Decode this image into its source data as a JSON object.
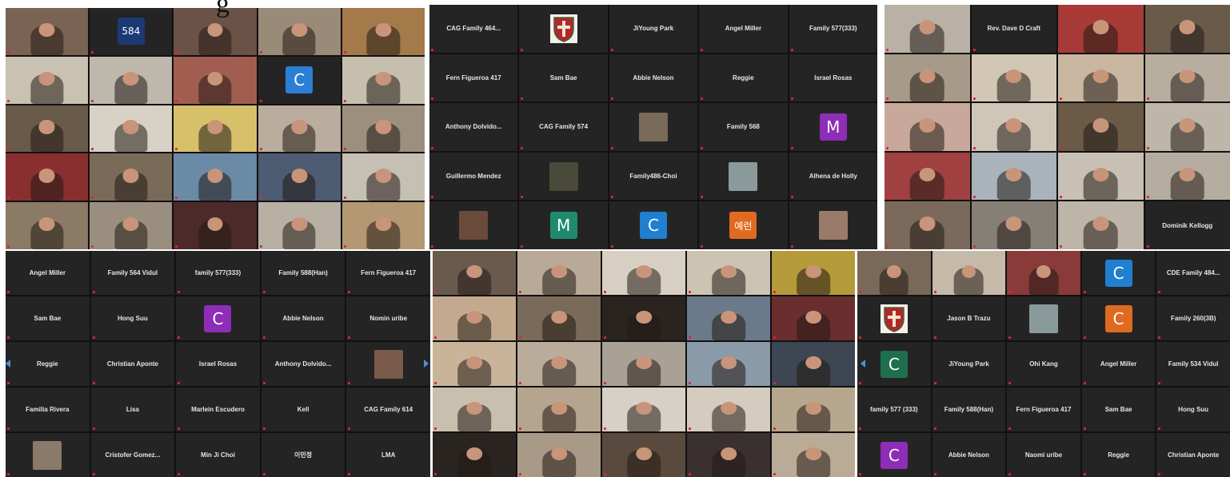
{
  "overlay_text": "g",
  "colors": {
    "panel_bg": "#1b1b1b",
    "tile_bg": "#242424",
    "name_text": "#e6e6e6"
  },
  "panels": [
    {
      "id": "p1",
      "cols": 5,
      "rows": 5,
      "tiles": [
        {
          "type": "video",
          "bg": "#7a6352"
        },
        {
          "type": "avatar",
          "text": "584",
          "color": "#1a3a74"
        },
        {
          "type": "video",
          "bg": "#6a5246"
        },
        {
          "type": "video",
          "bg": "#9a8a78"
        },
        {
          "type": "video",
          "bg": "#a47a4a"
        },
        {
          "type": "video",
          "bg": "#c9c1b2"
        },
        {
          "type": "video",
          "bg": "#bdb7ac"
        },
        {
          "type": "video",
          "bg": "#a25d51"
        },
        {
          "type": "avatar",
          "text": "C",
          "color": "#2a7fd4"
        },
        {
          "type": "video",
          "bg": "#c7bfae"
        },
        {
          "type": "video",
          "bg": "#6a5a4a"
        },
        {
          "type": "video",
          "bg": "#d8d2c6"
        },
        {
          "type": "video",
          "bg": "#d6c06a"
        },
        {
          "type": "video",
          "bg": "#b9ad9e"
        },
        {
          "type": "video",
          "bg": "#9c8f7e"
        },
        {
          "type": "video",
          "bg": "#8a2f2f"
        },
        {
          "type": "video",
          "bg": "#7a6a58"
        },
        {
          "type": "video",
          "bg": "#6a8aa6"
        },
        {
          "type": "video",
          "bg": "#4d5b73"
        },
        {
          "type": "video",
          "bg": "#c6bfb3"
        },
        {
          "type": "video",
          "bg": "#8a7a66"
        },
        {
          "type": "video",
          "bg": "#9a8e7e"
        },
        {
          "type": "video",
          "bg": "#4c2a2a"
        },
        {
          "type": "video",
          "bg": "#b8b0a2"
        },
        {
          "type": "video",
          "bg": "#b39872"
        }
      ]
    },
    {
      "id": "p2",
      "cols": 5,
      "rows": 5,
      "tiles": [
        {
          "type": "name",
          "text": "CAG Family 464..."
        },
        {
          "type": "logo"
        },
        {
          "type": "name",
          "text": "JiYoung Park"
        },
        {
          "type": "name",
          "text": "Angel Miller"
        },
        {
          "type": "name",
          "text": "Family 577(333)"
        },
        {
          "type": "name",
          "text": "Fern Figueroa 417"
        },
        {
          "type": "name",
          "text": "Sam Bae"
        },
        {
          "type": "name",
          "text": "Abbie Nelson"
        },
        {
          "type": "name",
          "text": "Reggie"
        },
        {
          "type": "name",
          "text": "Israel Rosas"
        },
        {
          "type": "name",
          "text": "Anthony  Dolvido..."
        },
        {
          "type": "name",
          "text": "CAG Family 574"
        },
        {
          "type": "photo",
          "color": "#7a6a5a"
        },
        {
          "type": "name",
          "text": "Family 568"
        },
        {
          "type": "avatar",
          "text": "M",
          "color": "#8e2db8"
        },
        {
          "type": "name",
          "text": "Guillermo Mendez"
        },
        {
          "type": "photo",
          "color": "#4a4a3a"
        },
        {
          "type": "name",
          "text": "Family486-Choi"
        },
        {
          "type": "photo",
          "color": "#8a9a9a"
        },
        {
          "type": "name",
          "text": "Alhena de Holly"
        },
        {
          "type": "photo",
          "color": "#6a4a3a"
        },
        {
          "type": "avatar",
          "text": "M",
          "color": "#1f8a6e"
        },
        {
          "type": "avatar",
          "text": "C",
          "color": "#1f7fd0"
        },
        {
          "type": "avatar",
          "text": "예런",
          "color": "#e06a20"
        },
        {
          "type": "photo",
          "color": "#9a7a6a"
        }
      ]
    },
    {
      "id": "p3",
      "cols": 4,
      "rows": 5,
      "tiles": [
        {
          "type": "video",
          "bg": "#b9b1a6"
        },
        {
          "type": "name",
          "text": "Rev. Dave D Craft"
        },
        {
          "type": "video",
          "bg": "#a73a36"
        },
        {
          "type": "video",
          "bg": "#6a5a4a"
        },
        {
          "type": "video",
          "bg": "#a89a88"
        },
        {
          "type": "video",
          "bg": "#d1c7b4"
        },
        {
          "type": "video",
          "bg": "#c9b7a2"
        },
        {
          "type": "video",
          "bg": "#b8aea0"
        },
        {
          "type": "video",
          "bg": "#c7a89a"
        },
        {
          "type": "video",
          "bg": "#cfc6b8"
        },
        {
          "type": "video",
          "bg": "#6a5a46"
        },
        {
          "type": "video",
          "bg": "#bdb6a9"
        },
        {
          "type": "video",
          "bg": "#a04040"
        },
        {
          "type": "video",
          "bg": "#aab3bb"
        },
        {
          "type": "video",
          "bg": "#c8c0b4"
        },
        {
          "type": "video",
          "bg": "#b5aca0"
        },
        {
          "type": "video",
          "bg": "#7b6a5b"
        },
        {
          "type": "video",
          "bg": "#867f75"
        },
        {
          "type": "video",
          "bg": "#bdb5a8"
        },
        {
          "type": "name",
          "text": "Dominik Kellogg"
        }
      ]
    },
    {
      "id": "p4",
      "cols": 5,
      "rows": 5,
      "tiles": [
        {
          "type": "name",
          "text": "Angel Miller"
        },
        {
          "type": "name",
          "text": "Family 564 Vidul"
        },
        {
          "type": "name",
          "text": "family 577(333)"
        },
        {
          "type": "name",
          "text": "Family 588(Han)"
        },
        {
          "type": "name",
          "text": "Fern Figueroa 417"
        },
        {
          "type": "name",
          "text": "Sam Bae"
        },
        {
          "type": "name",
          "text": "Hong Suu"
        },
        {
          "type": "avatar",
          "text": "C",
          "color": "#8e2db8"
        },
        {
          "type": "name",
          "text": "Abbie Nelson"
        },
        {
          "type": "name",
          "text": "Nomin uribe"
        },
        {
          "type": "name",
          "text": "Reggie"
        },
        {
          "type": "name",
          "text": "Christian Aponte"
        },
        {
          "type": "name",
          "text": "Israel Rosas"
        },
        {
          "type": "name",
          "text": "Anthony  Dolvido..."
        },
        {
          "type": "photo",
          "color": "#7a5a4a"
        },
        {
          "type": "name",
          "text": "Familia Rivera"
        },
        {
          "type": "name",
          "text": "Lisa"
        },
        {
          "type": "name",
          "text": "Marlein Escudero"
        },
        {
          "type": "name",
          "text": "Kell"
        },
        {
          "type": "name",
          "text": "CAG Family 614"
        },
        {
          "type": "photo",
          "color": "#8a7a6a"
        },
        {
          "type": "name",
          "text": "Cristofer Gomez..."
        },
        {
          "type": "name",
          "text": "Min Ji Choi"
        },
        {
          "type": "name",
          "text": "이민정"
        },
        {
          "type": "name",
          "text": "LMA"
        }
      ]
    },
    {
      "id": "p5",
      "cols": 5,
      "rows": 5,
      "tiles": [
        {
          "type": "video",
          "bg": "#6a5a4e"
        },
        {
          "type": "video",
          "bg": "#b9aa98"
        },
        {
          "type": "video",
          "bg": "#d7cfc2"
        },
        {
          "type": "video",
          "bg": "#cdc3b3"
        },
        {
          "type": "video",
          "bg": "#b59a3a"
        },
        {
          "type": "video",
          "bg": "#c3aa8e"
        },
        {
          "type": "video",
          "bg": "#7a6a5a"
        },
        {
          "type": "video",
          "bg": "#2a2420"
        },
        {
          "type": "video",
          "bg": "#6a7a8a"
        },
        {
          "type": "video",
          "bg": "#6a2e2e"
        },
        {
          "type": "video",
          "bg": "#c9b49a"
        },
        {
          "type": "video",
          "bg": "#b9ac9a"
        },
        {
          "type": "video",
          "bg": "#a9a196"
        },
        {
          "type": "video",
          "bg": "#8a9aa8"
        },
        {
          "type": "video",
          "bg": "#3d4652"
        },
        {
          "type": "video",
          "bg": "#c8bfae"
        },
        {
          "type": "video",
          "bg": "#b6a58e"
        },
        {
          "type": "video",
          "bg": "#d6d0c6"
        },
        {
          "type": "video",
          "bg": "#d4ccbf"
        },
        {
          "type": "video",
          "bg": "#b6a78e"
        },
        {
          "type": "video",
          "bg": "#2a2420"
        },
        {
          "type": "video",
          "bg": "#a89a86"
        },
        {
          "type": "video",
          "bg": "#5a4a3e"
        },
        {
          "type": "video",
          "bg": "#3a3030"
        },
        {
          "type": "video",
          "bg": "#b9ab96"
        }
      ]
    },
    {
      "id": "p6",
      "cols": 5,
      "rows": 5,
      "tiles": [
        {
          "type": "video",
          "bg": "#7a6858"
        },
        {
          "type": "video",
          "bg": "#c5b9a8"
        },
        {
          "type": "video",
          "bg": "#8a3a38"
        },
        {
          "type": "avatar",
          "text": "C",
          "color": "#1f7fd0"
        },
        {
          "type": "name",
          "text": "CDE Family 484..."
        },
        {
          "type": "logo"
        },
        {
          "type": "name",
          "text": "Jason B Trazu"
        },
        {
          "type": "photo",
          "color": "#8a9a9a"
        },
        {
          "type": "avatar",
          "text": "C",
          "color": "#e06a20"
        },
        {
          "type": "name",
          "text": "Family 260(3B)"
        },
        {
          "type": "avatar",
          "text": "C",
          "color": "#1f6e4e"
        },
        {
          "type": "name",
          "text": "JiYoung Park"
        },
        {
          "type": "name",
          "text": "Ohi Kang"
        },
        {
          "type": "name",
          "text": "Angel Miller"
        },
        {
          "type": "name",
          "text": "Family 534 Vidul"
        },
        {
          "type": "name",
          "text": "family 577 (333)"
        },
        {
          "type": "name",
          "text": "Family 588(Han)"
        },
        {
          "type": "name",
          "text": "Fern Figueroa 417"
        },
        {
          "type": "name",
          "text": "Sam Bae"
        },
        {
          "type": "name",
          "text": "Hong Suu"
        },
        {
          "type": "avatar",
          "text": "C",
          "color": "#8e2db8"
        },
        {
          "type": "name",
          "text": "Abbie Nelson"
        },
        {
          "type": "name",
          "text": "Naomi uribe"
        },
        {
          "type": "name",
          "text": "Reggie"
        },
        {
          "type": "name",
          "text": "Christian Aponte"
        }
      ]
    }
  ]
}
